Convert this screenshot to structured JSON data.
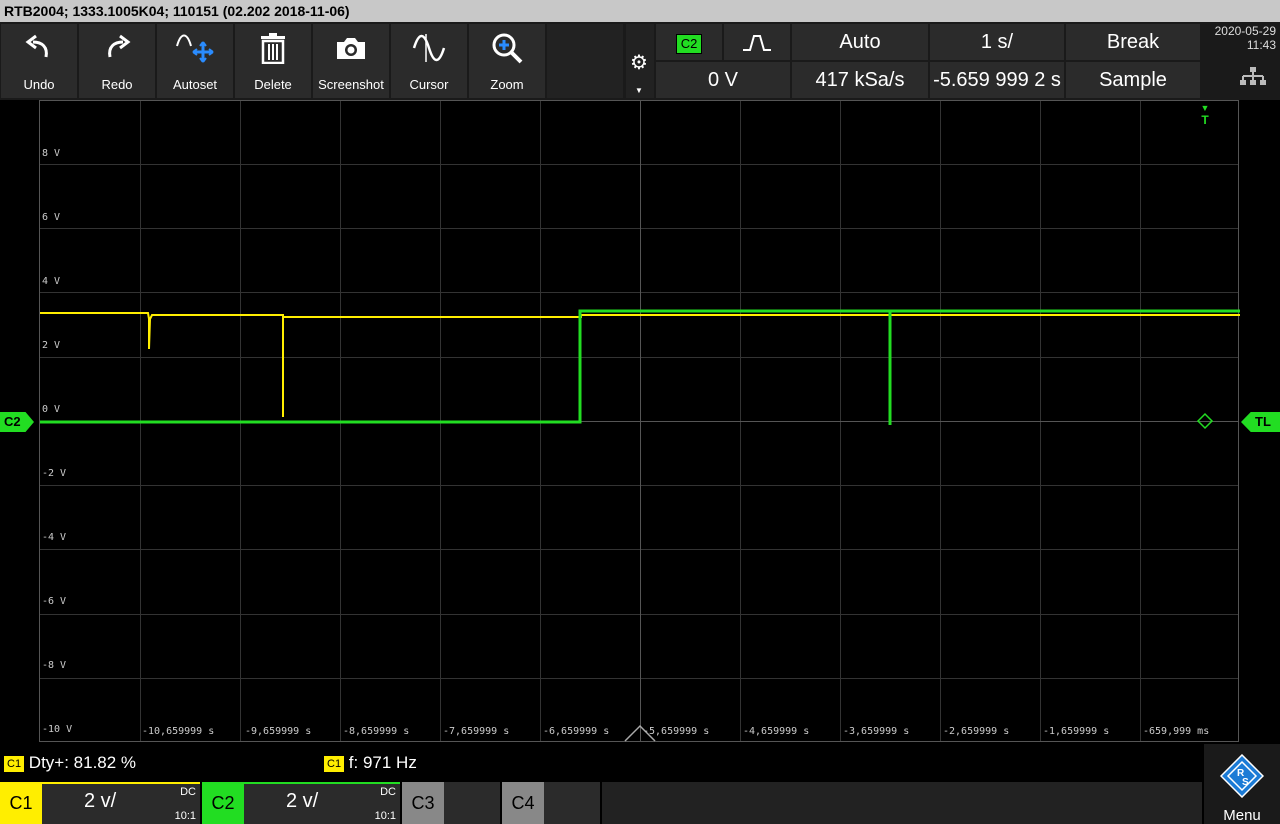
{
  "title": "RTB2004; 1333.1005K04; 110151 (02.202 2018-11-06)",
  "toolbar": {
    "undo": "Undo",
    "redo": "Redo",
    "autoset": "Autoset",
    "delete": "Delete",
    "screenshot": "Screenshot",
    "cursor": "Cursor",
    "zoom": "Zoom"
  },
  "trigger": {
    "source": "C2",
    "mode": "Auto",
    "timebase": "1 s/",
    "run": "Break",
    "level": "0 V",
    "sample_rate": "417 kSa/s",
    "position": "-5.659 999 2 s",
    "acq": "Sample"
  },
  "datetime": {
    "date": "2020-05-29",
    "time": "11:43"
  },
  "axis": {
    "y_labels": [
      "8 V",
      "6 V",
      "4 V",
      "2 V",
      "0 V",
      "-2 V",
      "-4 V",
      "-6 V",
      "-8 V",
      "-10 V"
    ],
    "x_labels": [
      "-10,659999 s",
      "-9,659999 s",
      "-8,659999 s",
      "-7,659999 s",
      "-6,659999 s",
      "-5,659999 s",
      "-4,659999 s",
      "-3,659999 s",
      "-2,659999 s",
      "-1,659999 s",
      "-659,999 ms"
    ]
  },
  "markers": {
    "ch_left": "C2",
    "trigger_top": "T",
    "trigger_right": "TL"
  },
  "measurements": [
    {
      "source": "C1",
      "text": "Dty+: 81.82 %"
    },
    {
      "source": "C1",
      "text": "f: 971 Hz"
    }
  ],
  "channels": [
    {
      "name": "C1",
      "scale": "2 v/",
      "coupling": "DC",
      "probe": "10:1",
      "color": "#ffee00"
    },
    {
      "name": "C2",
      "scale": "2 v/",
      "coupling": "DC",
      "probe": "10:1",
      "color": "#22dd22"
    },
    {
      "name": "C3"
    },
    {
      "name": "C4"
    }
  ],
  "menu": {
    "label": "Menu"
  },
  "colors": {
    "c1": "#ffee00",
    "c2": "#22dd22"
  }
}
